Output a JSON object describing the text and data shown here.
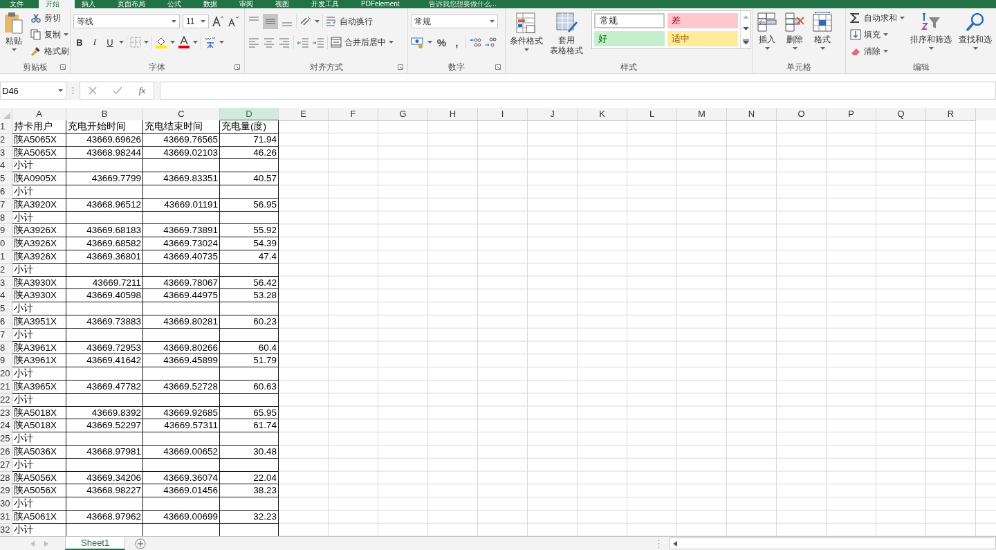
{
  "ribbon_tabs": [
    {
      "label": "文件",
      "selected": false
    },
    {
      "label": "开始",
      "selected": true
    },
    {
      "label": "插入",
      "selected": false
    },
    {
      "label": "页面布局",
      "selected": false
    },
    {
      "label": "公式",
      "selected": false
    },
    {
      "label": "数据",
      "selected": false
    },
    {
      "label": "审阅",
      "selected": false
    },
    {
      "label": "视图",
      "selected": false
    },
    {
      "label": "开发工具",
      "selected": false
    },
    {
      "label": "PDFelement",
      "selected": false
    }
  ],
  "tell_me": "告诉我您想要做什么...",
  "clipboard": {
    "title": "剪贴板",
    "paste": "粘贴",
    "cut": "剪切",
    "copy": "复制",
    "format_painter": "格式刷"
  },
  "font": {
    "title": "字体",
    "family": "等线",
    "size": "11",
    "bold": "B",
    "italic": "I",
    "underline": "U"
  },
  "alignment": {
    "title": "对齐方式",
    "wrap": "自动换行",
    "merge": "合并后居中"
  },
  "number": {
    "title": "数字",
    "format": "常规",
    "percent": "%",
    "comma": ","
  },
  "styles": {
    "title": "样式",
    "conditional": "条件格式",
    "table_format": [
      "套用",
      "表格格式"
    ],
    "cell_styles": [
      {
        "label": "常规",
        "kind": "normal"
      },
      {
        "label": "差",
        "kind": "bad"
      },
      {
        "label": "好",
        "kind": "good"
      },
      {
        "label": "适中",
        "kind": "neutral"
      }
    ]
  },
  "cells": {
    "title": "单元格",
    "insert": "插入",
    "delete": "删除",
    "format": "格式"
  },
  "editing": {
    "title": "编辑",
    "autosum": "自动求和",
    "fill": "填充",
    "clear": "清除",
    "sort": "排序和筛选",
    "find": "查找和选"
  },
  "formula_bar": {
    "name_box": "D46",
    "fx": "fx"
  },
  "columns": [
    {
      "label": "A",
      "selected": false
    },
    {
      "label": "B",
      "selected": false
    },
    {
      "label": "C",
      "selected": false
    },
    {
      "label": "D",
      "selected": true
    },
    {
      "label": "E",
      "selected": false
    },
    {
      "label": "F",
      "selected": false
    },
    {
      "label": "G",
      "selected": false
    },
    {
      "label": "H",
      "selected": false
    },
    {
      "label": "I",
      "selected": false
    },
    {
      "label": "J",
      "selected": false
    },
    {
      "label": "K",
      "selected": false
    },
    {
      "label": "L",
      "selected": false
    },
    {
      "label": "M",
      "selected": false
    },
    {
      "label": "N",
      "selected": false
    },
    {
      "label": "O",
      "selected": false
    },
    {
      "label": "P",
      "selected": false
    },
    {
      "label": "Q",
      "selected": false
    },
    {
      "label": "R",
      "selected": false
    }
  ],
  "rows": [
    {
      "header": "1",
      "kind": "header",
      "cells": [
        "持卡用户",
        "充电开始时间",
        "充电结束时间",
        "充电量(度)"
      ]
    },
    {
      "header": "2",
      "kind": "record",
      "cells": [
        "陕A5065X",
        "43669.69626",
        "43669.76565",
        "71.94"
      ]
    },
    {
      "header": "3",
      "kind": "record",
      "cells": [
        "陕A5065X",
        "43668.98244",
        "43669.02103",
        "46.26"
      ]
    },
    {
      "header": "4",
      "kind": "subtotal",
      "cells": [
        "小计"
      ]
    },
    {
      "header": "5",
      "kind": "record",
      "cells": [
        "陕A0905X",
        "43669.7799",
        "43669.83351",
        "40.57"
      ]
    },
    {
      "header": "6",
      "kind": "subtotal",
      "cells": [
        "小计"
      ]
    },
    {
      "header": "7",
      "kind": "record",
      "cells": [
        "陕A3920X",
        "43668.96512",
        "43669.01191",
        "56.95"
      ]
    },
    {
      "header": "8",
      "kind": "subtotal",
      "cells": [
        "小计"
      ]
    },
    {
      "header": "9",
      "kind": "record",
      "cells": [
        "陕A3926X",
        "43669.68183",
        "43669.73891",
        "55.92"
      ]
    },
    {
      "header": "0",
      "kind": "record",
      "cells": [
        "陕A3926X",
        "43669.68582",
        "43669.73024",
        "54.39"
      ]
    },
    {
      "header": "1",
      "kind": "record",
      "cells": [
        "陕A3926X",
        "43669.36801",
        "43669.40735",
        "47.4"
      ]
    },
    {
      "header": "2",
      "kind": "subtotal",
      "cells": [
        "小计"
      ]
    },
    {
      "header": "3",
      "kind": "record",
      "cells": [
        "陕A3930X",
        "43669.7211",
        "43669.78067",
        "56.42"
      ]
    },
    {
      "header": "4",
      "kind": "record",
      "cells": [
        "陕A3930X",
        "43669.40598",
        "43669.44975",
        "53.28"
      ]
    },
    {
      "header": "5",
      "kind": "subtotal",
      "cells": [
        "小计"
      ]
    },
    {
      "header": "6",
      "kind": "record",
      "cells": [
        "陕A3951X",
        "43669.73883",
        "43669.80281",
        "60.23"
      ]
    },
    {
      "header": "7",
      "kind": "subtotal",
      "cells": [
        "小计"
      ]
    },
    {
      "header": "8",
      "kind": "record",
      "cells": [
        "陕A3961X",
        "43669.72953",
        "43669.80266",
        "60.4"
      ]
    },
    {
      "header": "9",
      "kind": "record",
      "cells": [
        "陕A3961X",
        "43669.41642",
        "43669.45899",
        "51.79"
      ]
    },
    {
      "header": "20",
      "kind": "subtotal",
      "cells": [
        "小计"
      ]
    },
    {
      "header": "21",
      "kind": "record",
      "cells": [
        "陕A3965X",
        "43669.47782",
        "43669.52728",
        "60.63"
      ]
    },
    {
      "header": "22",
      "kind": "subtotal",
      "cells": [
        "小计"
      ]
    },
    {
      "header": "23",
      "kind": "record",
      "cells": [
        "陕A5018X",
        "43669.8392",
        "43669.92685",
        "65.95"
      ]
    },
    {
      "header": "24",
      "kind": "record",
      "cells": [
        "陕A5018X",
        "43669.52297",
        "43669.57311",
        "61.74"
      ]
    },
    {
      "header": "25",
      "kind": "subtotal",
      "cells": [
        "小计"
      ]
    },
    {
      "header": "26",
      "kind": "record",
      "cells": [
        "陕A5036X",
        "43668.97981",
        "43669.00652",
        "30.48"
      ]
    },
    {
      "header": "27",
      "kind": "subtotal",
      "cells": [
        "小计"
      ]
    },
    {
      "header": "28",
      "kind": "record",
      "cells": [
        "陕A5056X",
        "43669.34206",
        "43669.36074",
        "22.04"
      ]
    },
    {
      "header": "29",
      "kind": "record",
      "cells": [
        "陕A5056X",
        "43668.98227",
        "43669.01456",
        "38.23"
      ]
    },
    {
      "header": "30",
      "kind": "subtotal",
      "cells": [
        "小计"
      ]
    },
    {
      "header": "31",
      "kind": "record",
      "cells": [
        "陕A5061X",
        "43668.97962",
        "43669.00699",
        "32.23"
      ]
    },
    {
      "header": "32",
      "kind": "subtotal",
      "cells": [
        "小计"
      ]
    }
  ],
  "sheet_tabs": [
    {
      "label": "Sheet1",
      "selected": true
    }
  ]
}
